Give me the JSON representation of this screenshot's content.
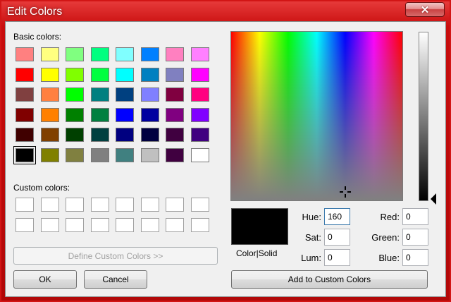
{
  "window": {
    "title": "Edit Colors",
    "close_glyph": "✕"
  },
  "labels": {
    "basic_colors": "Basic colors:",
    "custom_colors": "Custom colors:",
    "color_solid": "Color|Solid"
  },
  "basic_colors": [
    [
      "#ff8080",
      "#ffff80",
      "#80ff80",
      "#00ff80",
      "#80ffff",
      "#0080ff",
      "#ff80c0",
      "#ff80ff"
    ],
    [
      "#ff0000",
      "#ffff00",
      "#80ff00",
      "#00ff40",
      "#00ffff",
      "#0080c0",
      "#8080c0",
      "#ff00ff"
    ],
    [
      "#804040",
      "#ff8040",
      "#00ff00",
      "#008080",
      "#004080",
      "#8080ff",
      "#800040",
      "#ff0080"
    ],
    [
      "#800000",
      "#ff8000",
      "#008000",
      "#008040",
      "#0000ff",
      "#0000a0",
      "#800080",
      "#8000ff"
    ],
    [
      "#400000",
      "#804000",
      "#004000",
      "#004040",
      "#000080",
      "#000040",
      "#400040",
      "#400080"
    ],
    [
      "#000000",
      "#808000",
      "#808040",
      "#808080",
      "#408080",
      "#c0c0c0",
      "#400040",
      "#ffffff"
    ]
  ],
  "selected_basic": {
    "row": 5,
    "col": 0
  },
  "custom_colors": [
    [
      "#ffffff",
      "#ffffff",
      "#ffffff",
      "#ffffff",
      "#ffffff",
      "#ffffff",
      "#ffffff",
      "#ffffff"
    ],
    [
      "#ffffff",
      "#ffffff",
      "#ffffff",
      "#ffffff",
      "#ffffff",
      "#ffffff",
      "#ffffff",
      "#ffffff"
    ]
  ],
  "buttons": {
    "define_custom": "Define Custom Colors >>",
    "ok": "OK",
    "cancel": "Cancel",
    "add_custom": "Add to Custom Colors"
  },
  "fields": {
    "hue_label": "Hue:",
    "hue": "160",
    "sat_label": "Sat:",
    "sat": "0",
    "lum_label": "Lum:",
    "lum": "0",
    "red_label": "Red:",
    "red": "0",
    "green_label": "Green:",
    "green": "0",
    "blue_label": "Blue:",
    "blue": "0"
  },
  "current_color": "#000000",
  "colors": {
    "titlebar": "#c80d0d",
    "dialog_bg": "#f0f0f0"
  }
}
